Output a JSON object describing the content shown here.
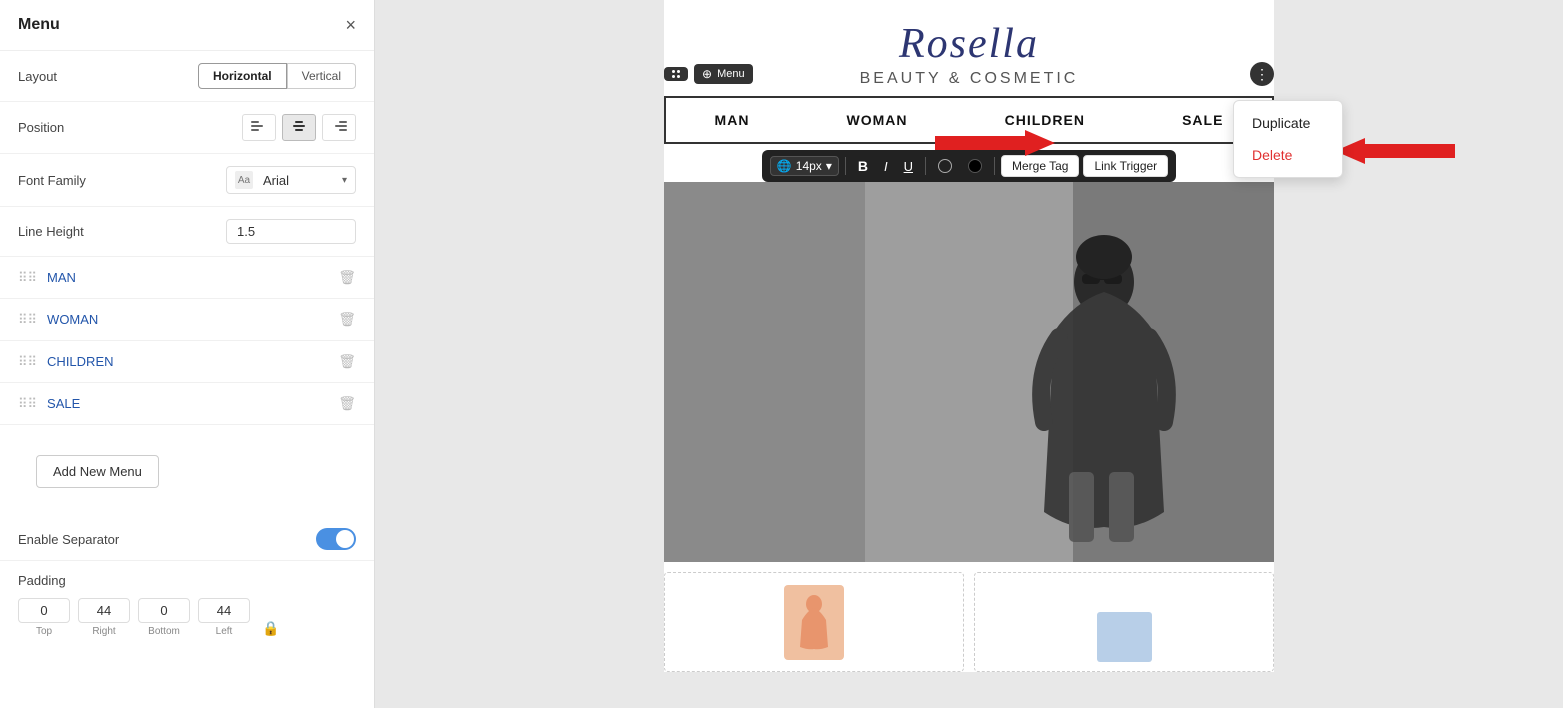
{
  "panel": {
    "title": "Menu",
    "close_label": "×",
    "layout": {
      "label": "Layout",
      "options": [
        "Horizontal",
        "Vertical"
      ],
      "active": "Horizontal"
    },
    "position": {
      "label": "Position",
      "options": [
        "left",
        "center",
        "right"
      ],
      "active": "center"
    },
    "font_family": {
      "label": "Font Family",
      "value": "Arial"
    },
    "line_height": {
      "label": "Line Height",
      "value": "1.5"
    },
    "menu_items": [
      {
        "label": "MAN"
      },
      {
        "label": "WOMAN"
      },
      {
        "label": "CHILDREN"
      },
      {
        "label": "SALE"
      }
    ],
    "add_menu_label": "Add New Menu",
    "enable_separator": {
      "label": "Enable Separator",
      "enabled": true
    },
    "padding": {
      "label": "Padding",
      "top": "0",
      "right": "44",
      "bottom": "0",
      "left": "44",
      "sublabels": [
        "Top",
        "Right",
        "Bottom",
        "Left"
      ]
    }
  },
  "canvas": {
    "store_logo": "Rosella",
    "store_tagline": "Beauty & Cosmetic",
    "menu_badge": "Menu",
    "nav_items": [
      "MAN",
      "WOMAN",
      "CHILDREN",
      "SALE"
    ],
    "text_toolbar": {
      "font_size": "14px",
      "tools": [
        "B",
        "I",
        "U"
      ],
      "merge_tag": "Merge Tag",
      "link_trigger": "Link Trigger"
    }
  },
  "context_menu": {
    "items": [
      "Duplicate",
      "Delete"
    ]
  },
  "icons": {
    "globe": "🌐",
    "drag": "⠿",
    "trash": "🗑",
    "close": "×",
    "more": "⋮",
    "lock": "🔒",
    "chevron_down": "▾"
  }
}
